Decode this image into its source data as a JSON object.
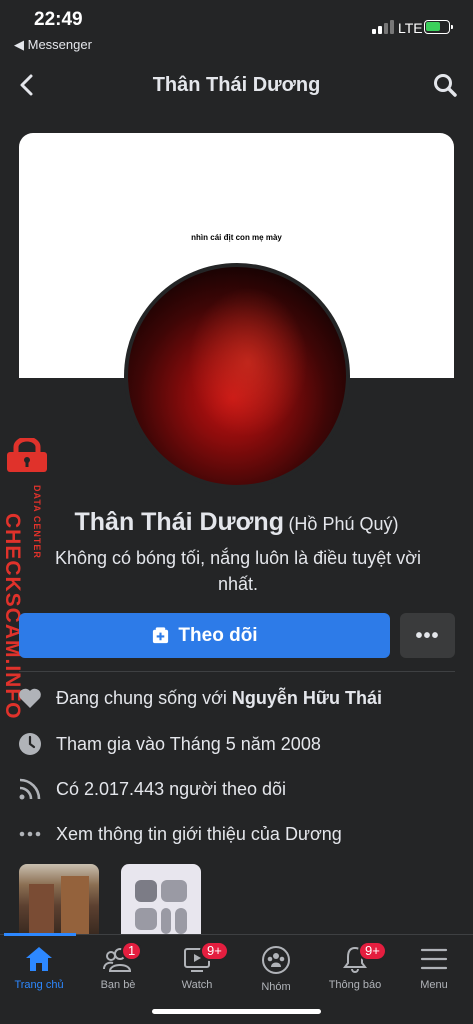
{
  "status_bar": {
    "time": "22:49",
    "back_app": "◀ Messenger",
    "network": "LTE",
    "battery_color": "#3cd05c"
  },
  "header": {
    "title": "Thân Thái Dương",
    "back_icon": "chevron-left-icon",
    "search_icon": "search-icon"
  },
  "cover": {
    "text": "nhìn cái địt con mẹ mày"
  },
  "watermark": {
    "main": "CHECKSCAM.INFO",
    "sub": "DATA CENTER",
    "color": "#e0322b"
  },
  "profile": {
    "name": "Thân Thái Dương",
    "alt_name": "(Hồ Phú Quý)",
    "bio": "Không có bóng tối, nắng luôn là điều tuyệt vời nhất."
  },
  "actions": {
    "follow_label": "Theo dõi",
    "more_label": "•••",
    "accent": "#2d7be8"
  },
  "info": {
    "relationship_prefix": "Đang chung sống với ",
    "relationship_name": "Nguyễn Hữu Thái",
    "joined": "Tham gia vào Tháng 5 năm 2008",
    "followers": "Có 2.017.443 người theo dõi",
    "about": "Xem thông tin giới thiệu của Dương"
  },
  "bottom_nav": {
    "items": [
      {
        "label": "Trang chủ",
        "icon": "home-icon",
        "active": true
      },
      {
        "label": "Bạn bè",
        "icon": "friends-icon",
        "badge": "1"
      },
      {
        "label": "Watch",
        "icon": "watch-icon",
        "badge": "9+"
      },
      {
        "label": "Nhóm",
        "icon": "groups-icon"
      },
      {
        "label": "Thông báo",
        "icon": "bell-icon",
        "badge": "9+"
      },
      {
        "label": "Menu",
        "icon": "menu-icon"
      }
    ],
    "active_color": "#2d88ff",
    "badge_color": "#e41e3f"
  }
}
